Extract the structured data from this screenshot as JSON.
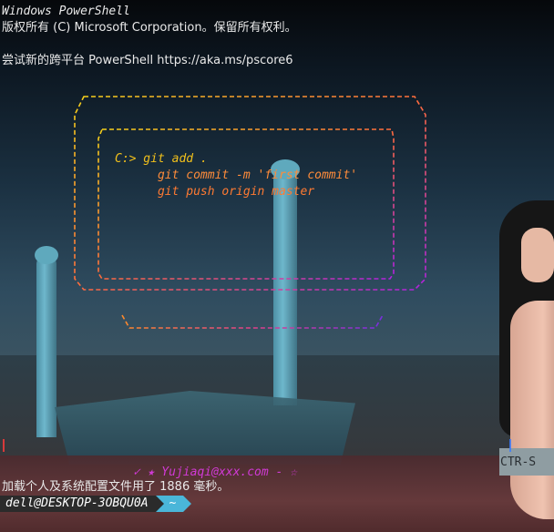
{
  "terminal": {
    "line1": "Windows PowerShell",
    "line2": "版权所有 (C) Microsoft Corporation。保留所有权利。",
    "line3": "尝试新的跨平台 PowerShell https://aka.ms/pscore6",
    "load_msg": "加载个人及系统配置文件用了 1886 毫秒。",
    "prompt_user": "dell@DESKTOP-3OBQU0A",
    "prompt_path": "~"
  },
  "ascii_art": {
    "code_line1": "C:> git add .",
    "code_line2": "      git commit -m 'first commit'",
    "code_line3": "      git push origin master",
    "signature": "✓ ★ Yujiaqi@xxx.com - ☆"
  },
  "wallpaper": {
    "sign_text": "CTR-S"
  },
  "colors": {
    "accent": "#4ab6d9",
    "prompt_bg": "#2b2b2b",
    "code_orange": "#ff8c3a",
    "code_yellow": "#f2c11b"
  }
}
